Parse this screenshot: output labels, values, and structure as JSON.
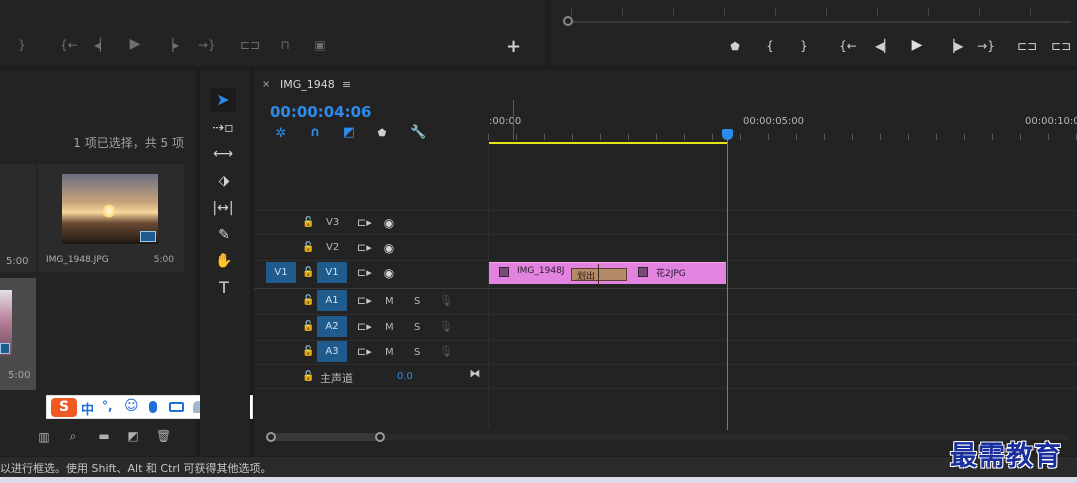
{
  "source_monitor": {
    "controls": [
      "mark-out",
      "step-to-in",
      "step-back",
      "play",
      "step-forward",
      "go-to-out",
      "insert",
      "overwrite",
      "export-frame"
    ],
    "add_label": "+"
  },
  "program_monitor": {
    "controls": [
      "mark-in",
      "mark-out-brace-left",
      "mark-out-brace-right",
      "go-to-in",
      "step-back",
      "play",
      "step-forward",
      "go-to-out",
      "lift",
      "extract"
    ]
  },
  "project": {
    "selection_status": "1 项已选择，共 5 项",
    "items": [
      {
        "name": "",
        "duration": "5:00"
      },
      {
        "name": "IMG_1948.JPG",
        "duration": "5:00"
      },
      {
        "name": "",
        "duration": "5:00"
      }
    ]
  },
  "ime_bar": {
    "logo": "S",
    "items": [
      "中",
      "°,",
      "☺",
      "🎤",
      "⌨",
      "👤",
      "👕",
      "▦"
    ]
  },
  "timeline": {
    "tab_name": "IMG_1948",
    "timecode": "00:00:04:06",
    "ruler": {
      "labels": [
        ":00:00",
        "00:00:05:00",
        "00:00:10:00"
      ]
    },
    "tracks_video": [
      "V3",
      "V2",
      "V1"
    ],
    "tracks_audio": [
      "A1",
      "A2",
      "A3"
    ],
    "source_patch": "V1",
    "mix_track": {
      "label": "主声道",
      "value": "0.0"
    },
    "audio_buttons": {
      "mute": "M",
      "solo": "S"
    },
    "clips": [
      {
        "name": "IMG_1948J",
        "fx": "fx"
      },
      {
        "name": "花2JPG",
        "fx": "fx"
      },
      {
        "transition": "划出"
      }
    ],
    "playhead_percent_of_ruler": 42
  },
  "status_bar": {
    "text": "以进行框选。使用 Shift、Alt 和 Ctrl 可获得其他选项。"
  },
  "watermark": "最需教育",
  "colors": {
    "accent_blue": "#2d8ceb",
    "clip_pink": "#e383e0",
    "work_area_yellow": "#e6e21a",
    "track_blue": "#1f5b8c"
  }
}
